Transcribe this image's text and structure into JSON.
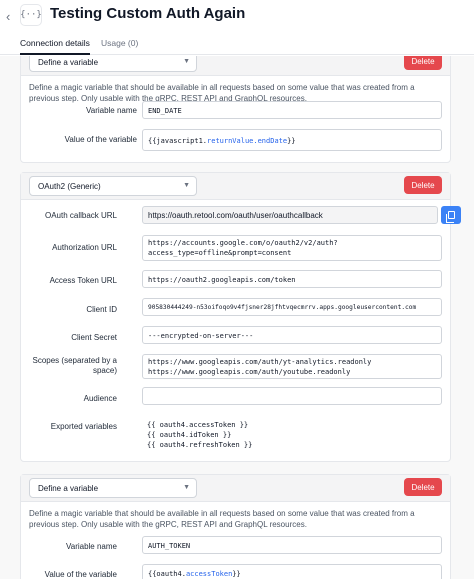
{
  "header": {
    "title": "Testing Custom Auth Again",
    "back_icon": "‹",
    "resource_icon": "{··}",
    "tabs": [
      {
        "label": "Connection details",
        "active": true
      },
      {
        "label": "Usage (0)",
        "active": false
      }
    ]
  },
  "colors": {
    "delete": "#e5484d",
    "copy": "#3b82f6",
    "highlight": "#2563eb"
  },
  "card1": {
    "type": "Define a variable",
    "delete_label": "Delete",
    "description": "Define a magic variable that should be available in all requests based on some value that was created from a previous step. Only usable with the gRPC, REST API and GraphQL resources.",
    "variable_name_label": "Variable name",
    "variable_name": "END_DATE",
    "value_label": "Value of the variable",
    "value_prefix": "{{javascript1.",
    "value_highlight": "returnValue.endDate",
    "value_suffix": "}}"
  },
  "card2": {
    "type": "OAuth2 (Generic)",
    "delete_label": "Delete",
    "callback_label": "OAuth callback URL",
    "callback_url": "https://oauth.retool.com/oauth/user/oauthcallback",
    "auth_url_label": "Authorization URL",
    "auth_url": "https://accounts.google.com/o/oauth2/v2/auth?\naccess_type=offline&prompt=consent",
    "token_url_label": "Access Token URL",
    "token_url": "https://oauth2.googleapis.com/token",
    "client_id_label": "Client ID",
    "client_id": "905830444249-n53oifoqo9v4fjsner28jfhtvqecmrrv.apps.googleusercontent.com",
    "client_secret_label": "Client Secret",
    "client_secret": "---encrypted-on-server---",
    "scopes_label": "Scopes (separated by a space)",
    "scopes": "https://www.googleapis.com/auth/yt-analytics.readonly\nhttps://www.googleapis.com/auth/youtube.readonly",
    "audience_label": "Audience",
    "audience": "",
    "exported_label": "Exported variables",
    "exported": "{{ oauth4.accessToken }}\n{{ oauth4.idToken }}\n{{ oauth4.refreshToken }}"
  },
  "card3": {
    "type": "Define a variable",
    "delete_label": "Delete",
    "description": "Define a magic variable that should be available in all requests based on some value that was created from a previous step. Only usable with the gRPC, REST API and GraphQL resources.",
    "variable_name_label": "Variable name",
    "variable_name": "AUTH_TOKEN",
    "value_label": "Value of the variable",
    "value_prefix": "{{oauth4.",
    "value_highlight": "accessToken",
    "value_suffix": "}}"
  }
}
